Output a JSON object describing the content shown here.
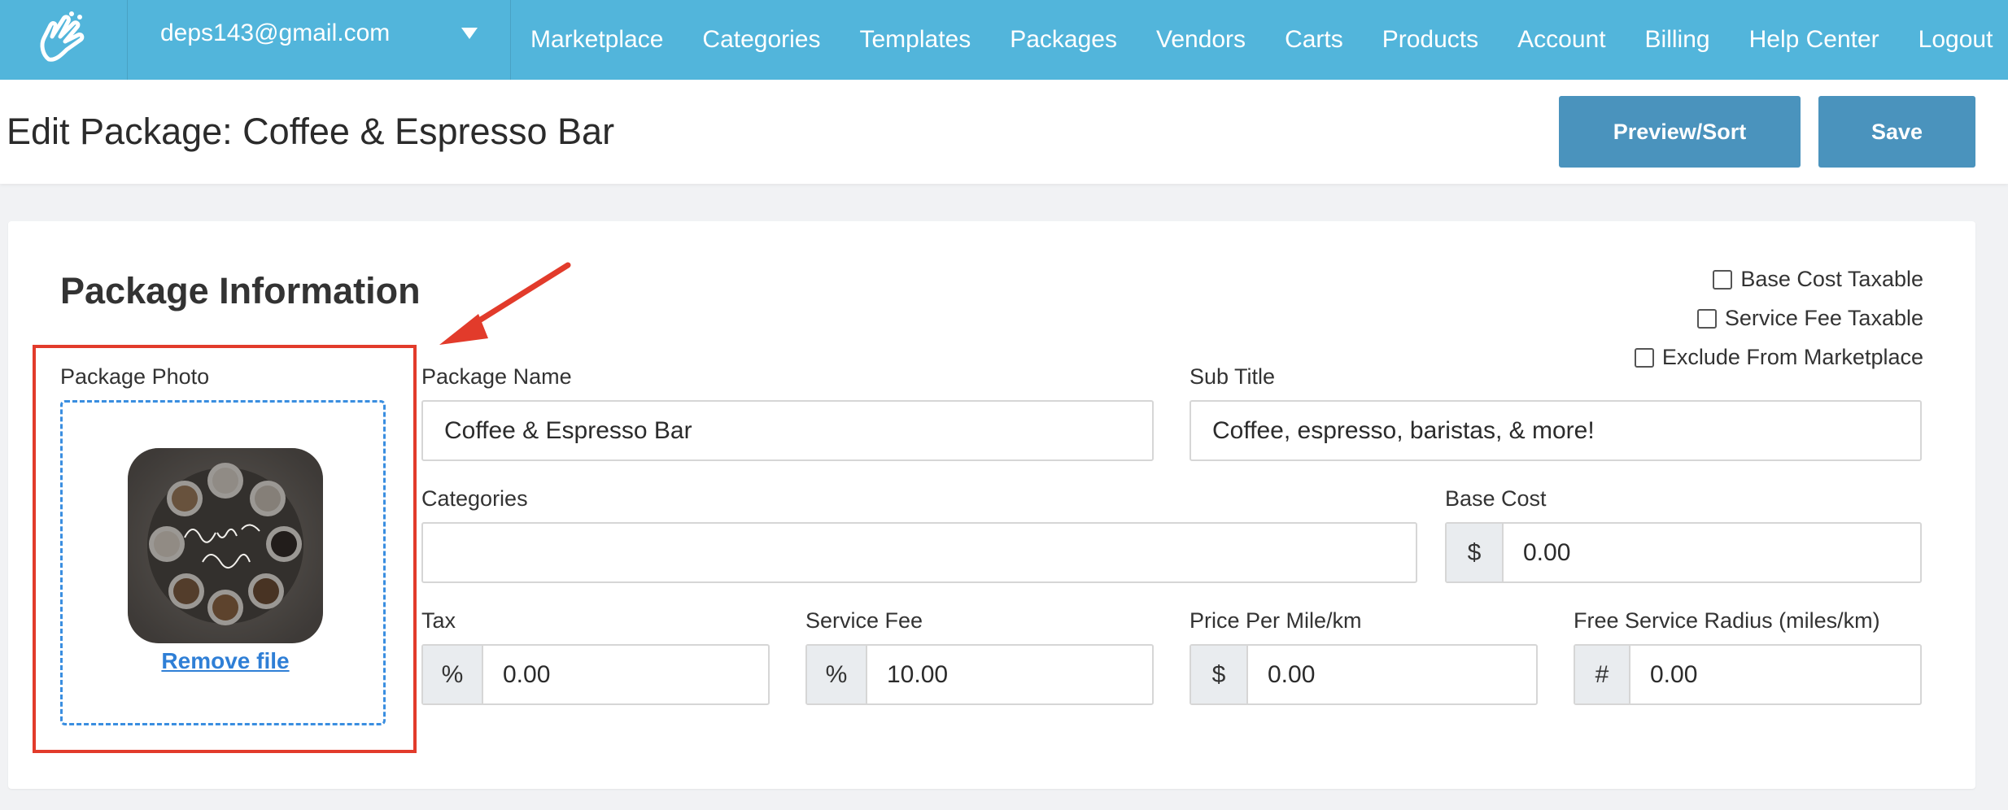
{
  "nav": {
    "account_email": "deps143@gmail.com",
    "links": [
      "Marketplace",
      "Categories",
      "Templates",
      "Packages",
      "Vendors",
      "Carts",
      "Products",
      "Account",
      "Billing",
      "Help Center",
      "Logout"
    ]
  },
  "header": {
    "title": "Edit Package: Coffee & Espresso Bar",
    "preview_label": "Preview/Sort",
    "save_label": "Save"
  },
  "package_info": {
    "section_title": "Package Information",
    "checkboxes": [
      {
        "label": "Base Cost Taxable",
        "checked": false
      },
      {
        "label": "Service Fee Taxable",
        "checked": false
      },
      {
        "label": "Exclude From Marketplace",
        "checked": false
      }
    ],
    "photo": {
      "label": "Package Photo",
      "remove_label": "Remove file"
    },
    "package_name": {
      "label": "Package Name",
      "value": "Coffee & Espresso Bar"
    },
    "sub_title": {
      "label": "Sub Title",
      "value": "Coffee, espresso, baristas, & more!"
    },
    "categories": {
      "label": "Categories",
      "value": ""
    },
    "base_cost": {
      "label": "Base Cost",
      "prefix": "$",
      "value": "0.00"
    },
    "tax": {
      "label": "Tax",
      "prefix": "%",
      "value": "0.00"
    },
    "service_fee": {
      "label": "Service Fee",
      "prefix": "%",
      "value": "10.00"
    },
    "price_per_mile": {
      "label": "Price Per Mile/km",
      "prefix": "$",
      "value": "0.00"
    },
    "free_radius": {
      "label": "Free Service Radius (miles/km)",
      "prefix": "#",
      "value": "0.00"
    }
  },
  "colors": {
    "navbar": "#52b5db",
    "button": "#4a93bd",
    "highlight": "#e23b2b",
    "dropzone_border": "#3a8ee0"
  }
}
